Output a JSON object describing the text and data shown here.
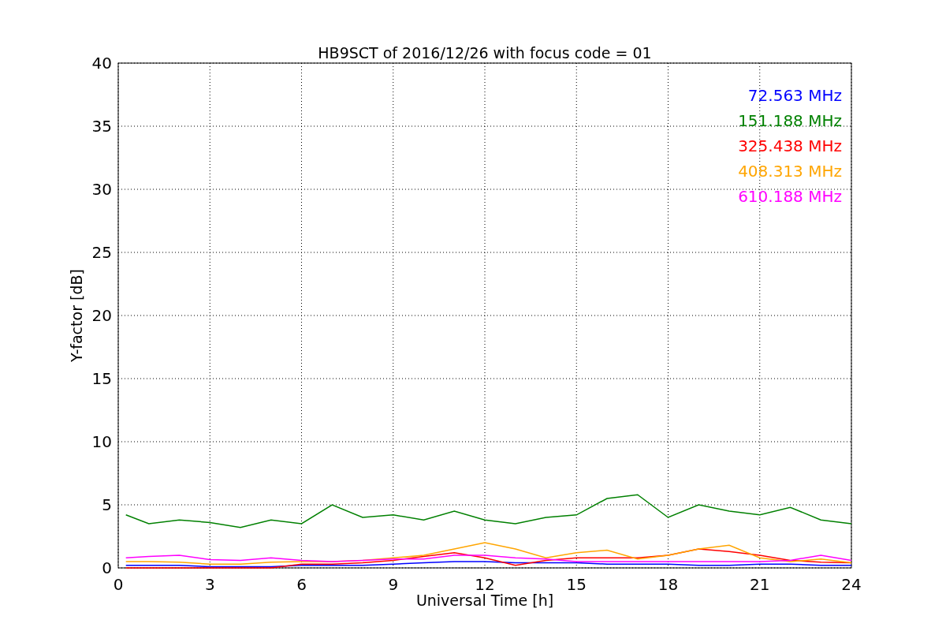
{
  "chart": {
    "chart_data": {
      "type": "line",
      "title": "HB9SCT of 2016/12/26 with focus code = 01",
      "xlabel": "Universal Time [h]",
      "ylabel": "Y-factor [dB]",
      "x": [
        0.25,
        1,
        2,
        3,
        4,
        5,
        6,
        7,
        8,
        9,
        10,
        11,
        12,
        13,
        14,
        15,
        16,
        17,
        18,
        19,
        20,
        21,
        22,
        23,
        24
      ],
      "series": [
        {
          "name": "72.563 MHz",
          "color": "#0000ff",
          "values": [
            0.2,
            0.2,
            0.2,
            0.1,
            0.1,
            0.1,
            0.2,
            0.2,
            0.2,
            0.3,
            0.4,
            0.5,
            0.5,
            0.4,
            0.4,
            0.4,
            0.3,
            0.3,
            0.3,
            0.2,
            0.2,
            0.3,
            0.3,
            0.2,
            0.2
          ]
        },
        {
          "name": "151.188 MHz",
          "color": "#008000",
          "values": [
            4.2,
            3.5,
            3.8,
            3.6,
            3.2,
            3.8,
            3.5,
            5,
            4,
            4.2,
            3.8,
            4.5,
            3.8,
            3.5,
            4,
            4.2,
            5.5,
            5.8,
            4,
            5,
            4.5,
            4.2,
            4.8,
            3.8,
            3.5
          ]
        },
        {
          "name": "325.438 MHz",
          "color": "#ff0000",
          "values": [
            0,
            0,
            0,
            0,
            0,
            0,
            0.3,
            0.3,
            0.4,
            0.6,
            0.9,
            1.2,
            0.8,
            0.2,
            0.6,
            0.8,
            0.8,
            0.8,
            1.0,
            1.5,
            1.3,
            1.0,
            0.6,
            0.45,
            0.4
          ]
        },
        {
          "name": "408.313 MHz",
          "color": "#ffa500",
          "values": [
            0.5,
            0.5,
            0.45,
            0.3,
            0.3,
            0.45,
            0.5,
            0.5,
            0.6,
            0.8,
            1.0,
            1.5,
            2.0,
            1.5,
            0.8,
            1.2,
            1.4,
            0.7,
            1.0,
            1.5,
            1.8,
            0.8,
            0.5,
            0.7,
            0.4
          ]
        },
        {
          "name": "610.188 MHz",
          "color": "#ff00ff",
          "values": [
            0.8,
            0.9,
            1.0,
            0.65,
            0.6,
            0.8,
            0.6,
            0.5,
            0.6,
            0.7,
            0.7,
            1.0,
            1.0,
            0.8,
            0.7,
            0.5,
            0.5,
            0.5,
            0.5,
            0.5,
            0.5,
            0.5,
            0.6,
            1.0,
            0.6
          ]
        }
      ],
      "grid": true,
      "xlim": [
        0,
        24
      ],
      "ylim": [
        0,
        40
      ],
      "xticks": [
        0,
        3,
        6,
        9,
        12,
        15,
        18,
        21,
        24
      ],
      "yticks": [
        0,
        5,
        10,
        15,
        20,
        25,
        30,
        35,
        40
      ]
    }
  }
}
